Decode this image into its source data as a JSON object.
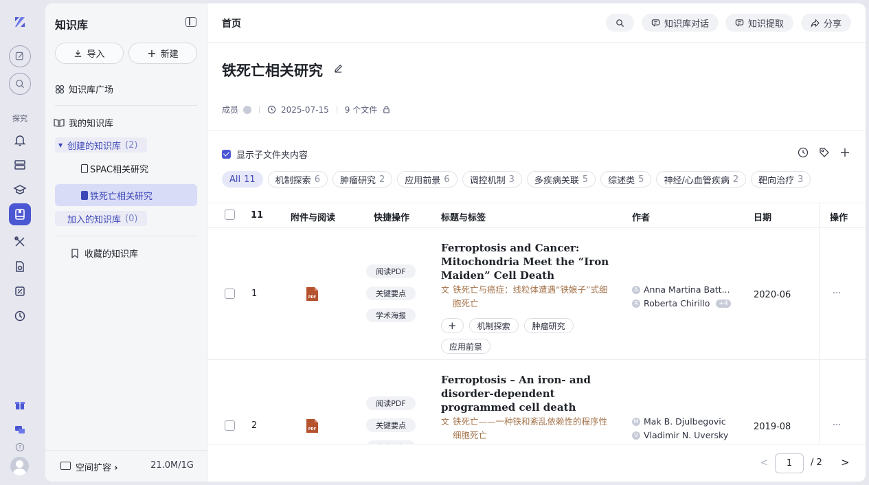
{
  "rail": {
    "section_label": "探究"
  },
  "sidebar": {
    "title": "知识库",
    "import_label": "导入",
    "new_label": "新建",
    "plaza": "知识库广场",
    "my_kb": "我的知识库",
    "created_group": {
      "label": "创建的知识库",
      "count": "(2)"
    },
    "created_items": [
      "SPAC相关研究",
      "铁死亡相关研究"
    ],
    "joined_group": {
      "label": "加入的知识库",
      "count": "(0)"
    },
    "favorites": "收藏的知识库",
    "footer_label": "空间扩容",
    "footer_size": "21.0M/1G"
  },
  "header": {
    "breadcrumb": "首页",
    "buttons": [
      "知识库对话",
      "知识提取",
      "分享"
    ]
  },
  "kb": {
    "title": "铁死亡相关研究",
    "members_label": "成员",
    "date": "2025-07-15",
    "file_count": "9 个文件"
  },
  "filter": {
    "show_subfolders": "显示子文件夹内容",
    "tags": [
      {
        "label": "All",
        "count": "11"
      },
      {
        "label": "机制探索",
        "count": "6"
      },
      {
        "label": "肿瘤研究",
        "count": "2"
      },
      {
        "label": "应用前景",
        "count": "6"
      },
      {
        "label": "调控机制",
        "count": "3"
      },
      {
        "label": "多疾病关联",
        "count": "5"
      },
      {
        "label": "综述类",
        "count": "5"
      },
      {
        "label": "神经/心血管疾病",
        "count": "2"
      },
      {
        "label": "靶向治疗",
        "count": "3"
      }
    ]
  },
  "table": {
    "headers": {
      "count": "11",
      "attach": "附件与阅读",
      "quick": "快捷操作",
      "title": "标题与标签",
      "author": "作者",
      "date": "日期",
      "ops": "操作"
    },
    "quick_actions": [
      "阅读PDF",
      "关键要点",
      "学术海报"
    ],
    "rows": [
      {
        "index": "1",
        "title": "Ferroptosis and Cancer: Mitochondria Meet the “Iron Maiden” Cell Death",
        "title_zh": "铁死亡与癌症：线粒体遭遇“铁娘子”式细胞死亡",
        "tags": [
          "机制探索",
          "肿瘤研究",
          "应用前景"
        ],
        "authors": [
          {
            "initial": "A",
            "name": "Anna Martina Batt..."
          },
          {
            "initial": "R",
            "name": "Roberta Chirillo",
            "more": "+4"
          }
        ],
        "date": "2020-06",
        "ops": "···"
      },
      {
        "index": "2",
        "title": "Ferroptosis – An iron- and disorder-dependent programmed cell death",
        "title_zh": "铁死亡——一种铁和紊乱依赖性的程序性细胞死亡",
        "tags": [],
        "authors": [
          {
            "initial": "M",
            "name": "Mak B. Djulbegovic"
          },
          {
            "initial": "V",
            "name": "Vladimir N. Uversky"
          }
        ],
        "date": "2019-08",
        "ops": "···"
      }
    ]
  },
  "pager": {
    "prev": "<",
    "current": "1",
    "total": "/ 2",
    "next": ">"
  },
  "colors": {
    "accent": "#4b56d2",
    "zh_title": "#a5744b",
    "pdf": "#b5532f"
  }
}
